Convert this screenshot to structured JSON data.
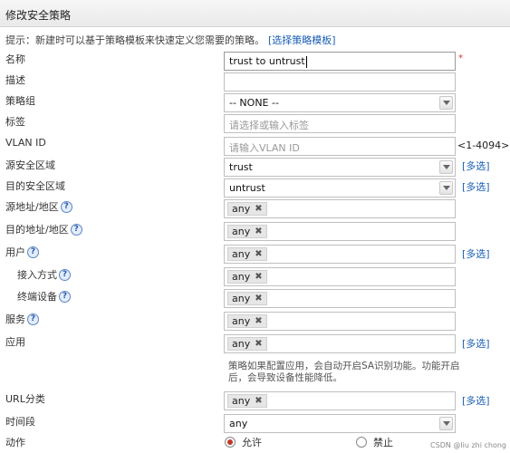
{
  "window": {
    "title": "修改安全策略"
  },
  "hint": {
    "text": "提示：新建时可以基于策略模板来快速定义您需要的策略。",
    "link": "[选择策略模板]"
  },
  "fields": {
    "name": {
      "label": "名称",
      "value": "trust to untrust",
      "required_mark": "*"
    },
    "description": {
      "label": "描述",
      "value": ""
    },
    "policy_group": {
      "label": "策略组",
      "value": "-- NONE --"
    },
    "tag": {
      "label": "标签",
      "placeholder": "请选择或输入标签"
    },
    "vlan_id": {
      "label": "VLAN ID",
      "placeholder": "请输入VLAN ID",
      "range": "<1-4094>"
    },
    "src_zone": {
      "label": "源安全区域",
      "value": "trust",
      "multi": "[多选]"
    },
    "dst_zone": {
      "label": "目的安全区域",
      "value": "untrust",
      "multi": "[多选]"
    },
    "src_addr": {
      "label": "源地址/地区",
      "tag": "any"
    },
    "dst_addr": {
      "label": "目的地址/地区",
      "tag": "any"
    },
    "user": {
      "label": "用户",
      "tag": "any",
      "multi": "[多选]"
    },
    "access_mode": {
      "label": "接入方式",
      "tag": "any"
    },
    "terminal": {
      "label": "终端设备",
      "tag": "any"
    },
    "service": {
      "label": "服务",
      "tag": "any"
    },
    "application": {
      "label": "应用",
      "tag": "any",
      "multi": "[多选]",
      "note": "策略如果配置应用，会自动开启SA识别功能。功能开启后，会导致设备性能降低。"
    },
    "url_category": {
      "label": "URL分类",
      "tag": "any",
      "multi": "[多选]"
    },
    "time_range": {
      "label": "时间段",
      "value": "any"
    },
    "action": {
      "label": "动作",
      "options": [
        "允许",
        "禁止"
      ],
      "selected": "允许"
    }
  },
  "help_glyph": "?",
  "remove_glyph": "✖",
  "watermark": "CSDN @liu zhi chong"
}
